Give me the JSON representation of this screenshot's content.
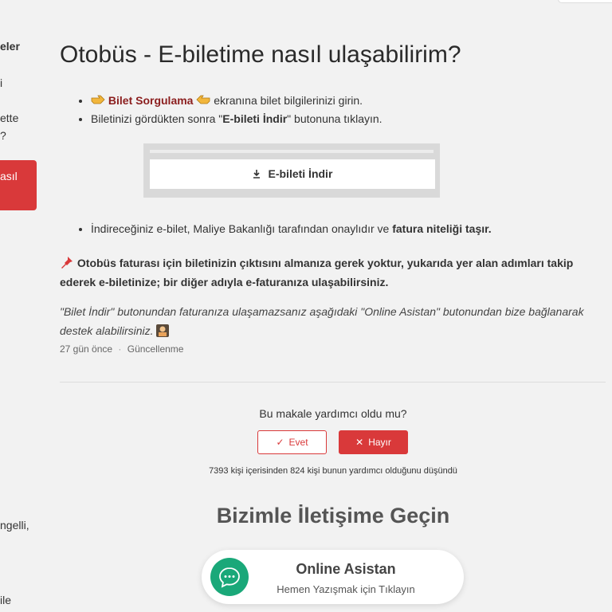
{
  "sidebar": {
    "items": [
      {
        "label": "eler"
      },
      {
        "label": "i"
      },
      {
        "label": "ette"
      },
      {
        "label": "?"
      },
      {
        "label": "asıl"
      },
      {
        "label": "ngelli,"
      },
      {
        "label": "ile"
      }
    ]
  },
  "article": {
    "title": "Otobüs - E-biletime nasıl ulaşabilirim?",
    "step1_link": "Bilet Sorgulama",
    "step1_text": " ekranına bilet bilgilerinizi girin.",
    "step2_before": "Biletinizi gördükten sonra \"",
    "step2_bold": "E-bileti İndir",
    "step2_after": "\" butonuna tıklayın.",
    "mock_button_label": "E-bileti İndir",
    "step3_text": "İndireceğiniz e-bilet, Maliye Bakanlığı tarafından onaylıdır ve ",
    "step3_bold": "fatura niteliği taşır.",
    "notice": "Otobüs faturası için biletinizin çıktısını almanıza gerek yoktur, yukarıda yer alan adımları takip ederek e-biletinize; bir diğer adıyla e-faturanıza ulaşabilirsiniz.",
    "italic_note": "\"Bilet İndir\" butonundan faturanıza ulaşamazsanız aşağıdaki \"Online Asistan\" butonundan bize bağlanarak destek alabilirsiniz.",
    "meta_age": "27 gün önce",
    "meta_sep": "·",
    "meta_updated": "Güncellenme"
  },
  "feedback": {
    "question": "Bu makale yardımcı oldu mu?",
    "yes_label": "Evet",
    "no_label": "Hayır",
    "count_text": "7393 kişi içerisinden 824 kişi bunun yardımcı olduğunu düşündü"
  },
  "contact": {
    "title": "Bizimle İletişime Geçin",
    "assistant_name": "Online Asistan",
    "assistant_sub": "Hemen Yazışmak için Tıklayın"
  },
  "colors": {
    "accent_red": "#d9393a",
    "link_red": "#8b1e1e",
    "assistant_green": "#1aa879"
  }
}
